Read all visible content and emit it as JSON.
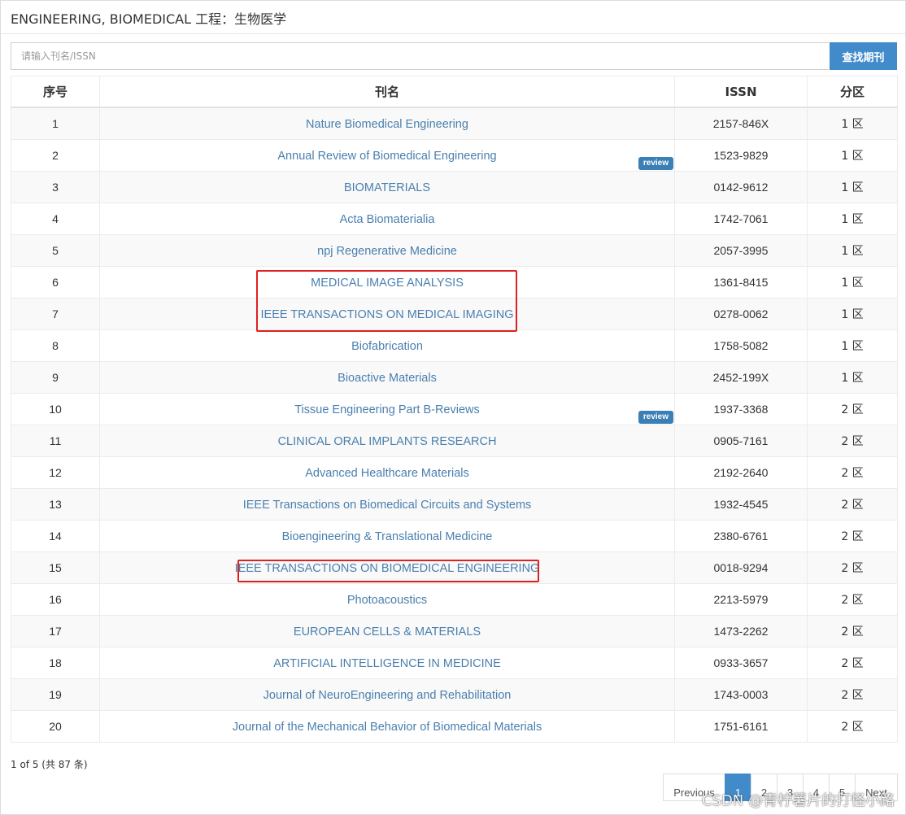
{
  "panel": {
    "title": "ENGINEERING, BIOMEDICAL 工程：生物医学"
  },
  "search": {
    "placeholder": "请输入刊名/ISSN",
    "value": "",
    "button_label": "查找期刊"
  },
  "table": {
    "headers": {
      "index": "序号",
      "name": "刊名",
      "issn": "ISSN",
      "zone": "分区"
    },
    "rows": [
      {
        "index": "1",
        "name": "Nature Biomedical Engineering",
        "issn": "2157-846X",
        "zone": "1 区",
        "badge": ""
      },
      {
        "index": "2",
        "name": "Annual Review of Biomedical Engineering",
        "issn": "1523-9829",
        "zone": "1 区",
        "badge": "review"
      },
      {
        "index": "3",
        "name": "BIOMATERIALS",
        "issn": "0142-9612",
        "zone": "1 区",
        "badge": ""
      },
      {
        "index": "4",
        "name": "Acta Biomaterialia",
        "issn": "1742-7061",
        "zone": "1 区",
        "badge": ""
      },
      {
        "index": "5",
        "name": "npj Regenerative Medicine",
        "issn": "2057-3995",
        "zone": "1 区",
        "badge": ""
      },
      {
        "index": "6",
        "name": "MEDICAL IMAGE ANALYSIS",
        "issn": "1361-8415",
        "zone": "1 区",
        "badge": ""
      },
      {
        "index": "7",
        "name": "IEEE TRANSACTIONS ON MEDICAL IMAGING",
        "issn": "0278-0062",
        "zone": "1 区",
        "badge": ""
      },
      {
        "index": "8",
        "name": "Biofabrication",
        "issn": "1758-5082",
        "zone": "1 区",
        "badge": ""
      },
      {
        "index": "9",
        "name": "Bioactive Materials",
        "issn": "2452-199X",
        "zone": "1 区",
        "badge": ""
      },
      {
        "index": "10",
        "name": "Tissue Engineering Part B-Reviews",
        "issn": "1937-3368",
        "zone": "2 区",
        "badge": "review"
      },
      {
        "index": "11",
        "name": "CLINICAL ORAL IMPLANTS RESEARCH",
        "issn": "0905-7161",
        "zone": "2 区",
        "badge": ""
      },
      {
        "index": "12",
        "name": "Advanced Healthcare Materials",
        "issn": "2192-2640",
        "zone": "2 区",
        "badge": ""
      },
      {
        "index": "13",
        "name": "IEEE Transactions on Biomedical Circuits and Systems",
        "issn": "1932-4545",
        "zone": "2 区",
        "badge": ""
      },
      {
        "index": "14",
        "name": "Bioengineering & Translational Medicine",
        "issn": "2380-6761",
        "zone": "2 区",
        "badge": ""
      },
      {
        "index": "15",
        "name": "IEEE TRANSACTIONS ON BIOMEDICAL ENGINEERING",
        "issn": "0018-9294",
        "zone": "2 区",
        "badge": ""
      },
      {
        "index": "16",
        "name": "Photoacoustics",
        "issn": "2213-5979",
        "zone": "2 区",
        "badge": ""
      },
      {
        "index": "17",
        "name": "EUROPEAN CELLS & MATERIALS",
        "issn": "1473-2262",
        "zone": "2 区",
        "badge": ""
      },
      {
        "index": "18",
        "name": "ARTIFICIAL INTELLIGENCE IN MEDICINE",
        "issn": "0933-3657",
        "zone": "2 区",
        "badge": ""
      },
      {
        "index": "19",
        "name": "Journal of NeuroEngineering and Rehabilitation",
        "issn": "1743-0003",
        "zone": "2 区",
        "badge": ""
      },
      {
        "index": "20",
        "name": "Journal of the Mechanical Behavior of Biomedical Materials",
        "issn": "1751-6161",
        "zone": "2 区",
        "badge": ""
      }
    ]
  },
  "pagination": {
    "info": "1 of 5 (共 87 条)",
    "prev_label": "Previous",
    "next_label": "Next",
    "pages": [
      "1",
      "2",
      "3",
      "4",
      "5"
    ],
    "current": "1"
  },
  "watermark": "CSDN @青柠薯片的打怪小路",
  "colors": {
    "link": "#4a7fae",
    "accent": "#428bca",
    "badge": "#3a7fb5",
    "highlight": "#e02020"
  }
}
